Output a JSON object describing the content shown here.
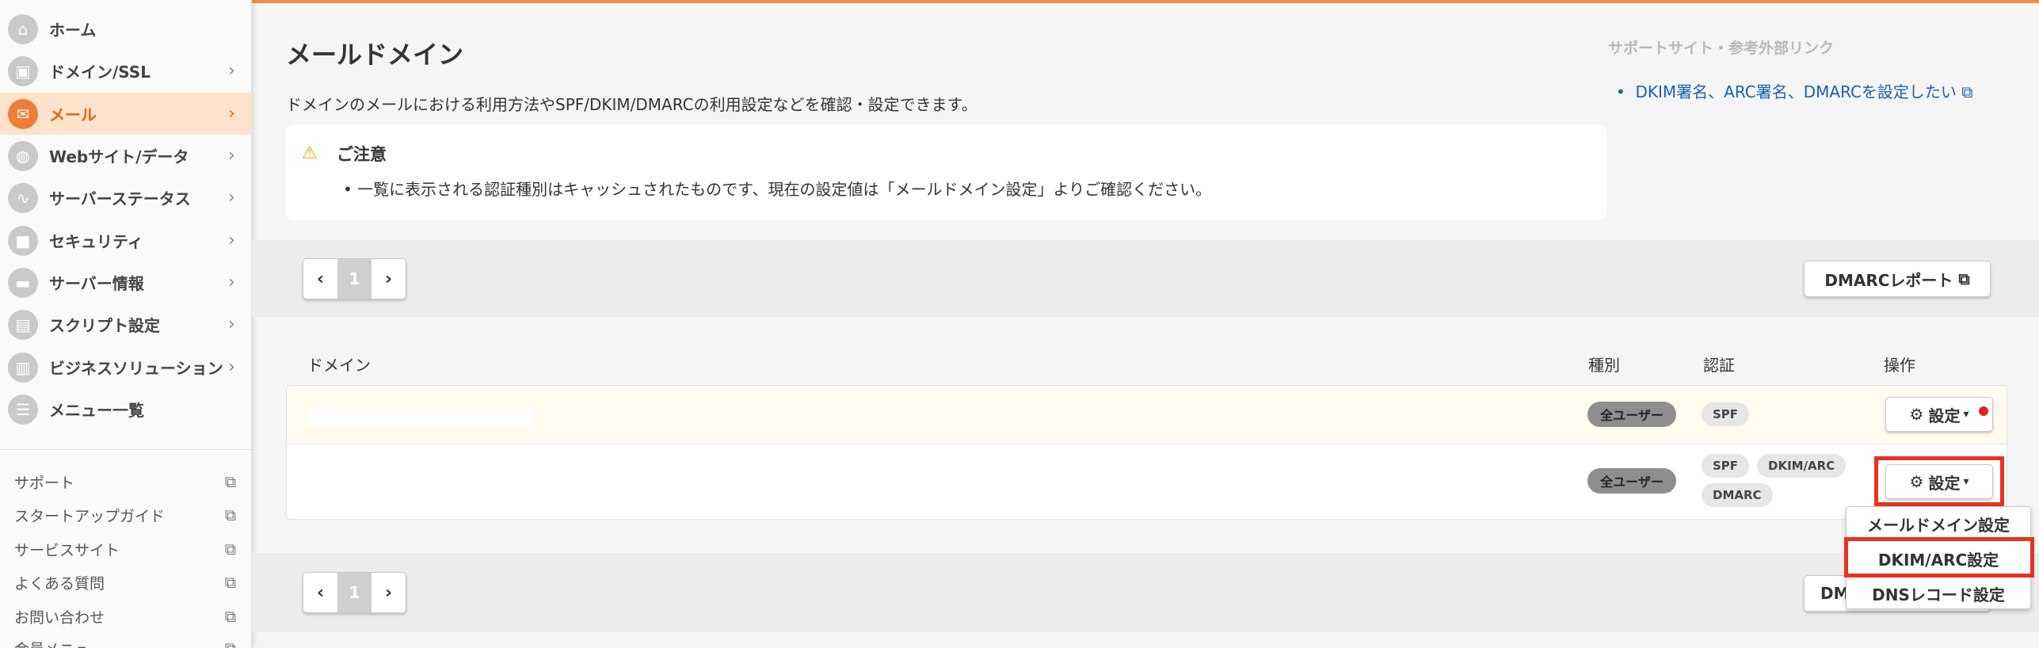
{
  "sidebar": {
    "items": [
      {
        "label": "ホーム",
        "icon": "home-icon",
        "glyph": "⌂"
      },
      {
        "label": "ドメイン/SSL",
        "icon": "domain-icon",
        "glyph": "▣"
      },
      {
        "label": "メール",
        "icon": "mail-icon",
        "glyph": "✉"
      },
      {
        "label": "Webサイト/データ",
        "icon": "globe-icon",
        "glyph": "◍"
      },
      {
        "label": "サーバーステータス",
        "icon": "chart-icon",
        "glyph": "∿"
      },
      {
        "label": "セキュリティ",
        "icon": "lock-icon",
        "glyph": "■"
      },
      {
        "label": "サーバー情報",
        "icon": "server-icon",
        "glyph": "▬"
      },
      {
        "label": "スクリプト設定",
        "icon": "script-icon",
        "glyph": "▤"
      },
      {
        "label": "ビジネスソリューション",
        "icon": "briefcase-icon",
        "glyph": "▥"
      },
      {
        "label": "メニュー一覧",
        "icon": "list-icon",
        "glyph": "☰"
      }
    ],
    "links": [
      {
        "label": "サポート"
      },
      {
        "label": "スタートアップガイド"
      },
      {
        "label": "サービスサイト"
      },
      {
        "label": "よくある質問"
      },
      {
        "label": "お問い合わせ"
      },
      {
        "label": "会員メニュー"
      }
    ]
  },
  "main": {
    "title": "メールドメイン",
    "description": "ドメインのメールにおける利用方法やSPF/DKIM/DMARCの利用設定などを確認・設定できます。",
    "notice": {
      "title": "ご注意",
      "item": "一覧に表示される認証種別はキャッシュされたものです、現在の設定値は「メールドメイン設定」よりご確認ください。"
    },
    "support": {
      "title": "サポートサイト・参考外部リンク",
      "link": "DKIM署名、ARC署名、DMARCを設定したい"
    },
    "pager": {
      "prev": "‹",
      "page": "1",
      "next": "›"
    },
    "dmarc_report_label": "DMARCレポート",
    "dmarc_report_bottom_partial": "DM",
    "table": {
      "headers": {
        "domain": "ドメイン",
        "type": "種別",
        "auth": "認証",
        "action": "操作"
      },
      "rows": [
        {
          "domain": "",
          "type": "全ユーザー",
          "auth": [
            "SPF"
          ],
          "action": "設定"
        },
        {
          "domain": "",
          "type": "全ユーザー",
          "auth": [
            "SPF",
            "DKIM/ARC",
            "DMARC"
          ],
          "action": "設定"
        }
      ]
    },
    "dropdown": [
      "メールドメイン設定",
      "DKIM/ARC設定",
      "DNSレコード設定"
    ]
  },
  "colors": {
    "accent": "#ee7d3a",
    "highlight": "#e8321f",
    "link": "#1a5fb4"
  }
}
